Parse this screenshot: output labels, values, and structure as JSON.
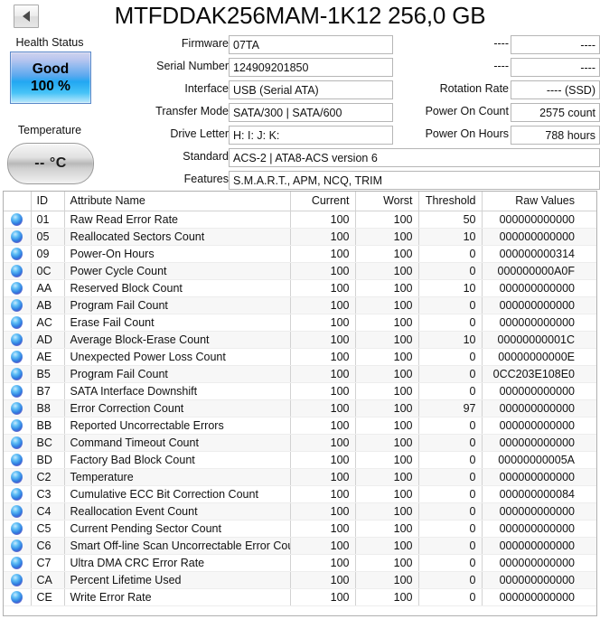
{
  "window": {
    "title": "MTFDDAK256MAM-1K12 256,0 GB",
    "nav_prev_icon": "triangle-left-icon"
  },
  "health": {
    "label": "Health Status",
    "status": "Good",
    "percent": "100 %",
    "color": "#22a7f2"
  },
  "temperature": {
    "label": "Temperature",
    "value": "-- °C"
  },
  "info": {
    "rows": [
      {
        "label": "Firmware",
        "value": "07TA",
        "label2": "----",
        "value2": "----"
      },
      {
        "label": "Serial Number",
        "value": "124909201850",
        "label2": "----",
        "value2": "----"
      },
      {
        "label": "Interface",
        "value": "USB (Serial ATA)",
        "label2": "Rotation Rate",
        "value2": "---- (SSD)"
      },
      {
        "label": "Transfer Mode",
        "value": "SATA/300 | SATA/600",
        "label2": "Power On Count",
        "value2": "2575 count"
      },
      {
        "label": "Drive Letter",
        "value": "H: I: J: K:",
        "label2": "Power On Hours",
        "value2": "788 hours"
      }
    ],
    "wide_rows": [
      {
        "label": "Standard",
        "value": "ACS-2 | ATA8-ACS version 6"
      },
      {
        "label": "Features",
        "value": "S.M.A.R.T., APM, NCQ, TRIM"
      }
    ]
  },
  "attributes": {
    "columns": [
      "",
      "ID",
      "Attribute Name",
      "Current",
      "Worst",
      "Threshold",
      "Raw Values"
    ],
    "rows": [
      {
        "icon": "status-sphere-icon",
        "id": "01",
        "name": "Raw Read Error Rate",
        "current": "100",
        "worst": "100",
        "threshold": "50",
        "raw": "000000000000"
      },
      {
        "icon": "status-sphere-icon",
        "id": "05",
        "name": "Reallocated Sectors Count",
        "current": "100",
        "worst": "100",
        "threshold": "10",
        "raw": "000000000000"
      },
      {
        "icon": "status-sphere-icon",
        "id": "09",
        "name": "Power-On Hours",
        "current": "100",
        "worst": "100",
        "threshold": "0",
        "raw": "000000000314"
      },
      {
        "icon": "status-sphere-icon",
        "id": "0C",
        "name": "Power Cycle Count",
        "current": "100",
        "worst": "100",
        "threshold": "0",
        "raw": "000000000A0F"
      },
      {
        "icon": "status-sphere-icon",
        "id": "AA",
        "name": "Reserved Block Count",
        "current": "100",
        "worst": "100",
        "threshold": "10",
        "raw": "000000000000"
      },
      {
        "icon": "status-sphere-icon",
        "id": "AB",
        "name": "Program Fail Count",
        "current": "100",
        "worst": "100",
        "threshold": "0",
        "raw": "000000000000"
      },
      {
        "icon": "status-sphere-icon",
        "id": "AC",
        "name": "Erase Fail Count",
        "current": "100",
        "worst": "100",
        "threshold": "0",
        "raw": "000000000000"
      },
      {
        "icon": "status-sphere-icon",
        "id": "AD",
        "name": "Average Block-Erase Count",
        "current": "100",
        "worst": "100",
        "threshold": "10",
        "raw": "00000000001C"
      },
      {
        "icon": "status-sphere-icon",
        "id": "AE",
        "name": "Unexpected Power Loss Count",
        "current": "100",
        "worst": "100",
        "threshold": "0",
        "raw": "00000000000E"
      },
      {
        "icon": "status-sphere-icon",
        "id": "B5",
        "name": "Program Fail Count",
        "current": "100",
        "worst": "100",
        "threshold": "0",
        "raw": "0CC203E108E0"
      },
      {
        "icon": "status-sphere-icon",
        "id": "B7",
        "name": "SATA Interface Downshift",
        "current": "100",
        "worst": "100",
        "threshold": "0",
        "raw": "000000000000"
      },
      {
        "icon": "status-sphere-icon",
        "id": "B8",
        "name": "Error Correction Count",
        "current": "100",
        "worst": "100",
        "threshold": "97",
        "raw": "000000000000"
      },
      {
        "icon": "status-sphere-icon",
        "id": "BB",
        "name": "Reported Uncorrectable Errors",
        "current": "100",
        "worst": "100",
        "threshold": "0",
        "raw": "000000000000"
      },
      {
        "icon": "status-sphere-icon",
        "id": "BC",
        "name": "Command Timeout Count",
        "current": "100",
        "worst": "100",
        "threshold": "0",
        "raw": "000000000000"
      },
      {
        "icon": "status-sphere-icon",
        "id": "BD",
        "name": "Factory Bad Block Count",
        "current": "100",
        "worst": "100",
        "threshold": "0",
        "raw": "00000000005A"
      },
      {
        "icon": "status-sphere-icon",
        "id": "C2",
        "name": "Temperature",
        "current": "100",
        "worst": "100",
        "threshold": "0",
        "raw": "000000000000"
      },
      {
        "icon": "status-sphere-icon",
        "id": "C3",
        "name": "Cumulative ECC Bit Correction Count",
        "current": "100",
        "worst": "100",
        "threshold": "0",
        "raw": "000000000084"
      },
      {
        "icon": "status-sphere-icon",
        "id": "C4",
        "name": "Reallocation Event Count",
        "current": "100",
        "worst": "100",
        "threshold": "0",
        "raw": "000000000000"
      },
      {
        "icon": "status-sphere-icon",
        "id": "C5",
        "name": "Current Pending Sector Count",
        "current": "100",
        "worst": "100",
        "threshold": "0",
        "raw": "000000000000"
      },
      {
        "icon": "status-sphere-icon",
        "id": "C6",
        "name": "Smart Off-line Scan Uncorrectable Error Count",
        "current": "100",
        "worst": "100",
        "threshold": "0",
        "raw": "000000000000"
      },
      {
        "icon": "status-sphere-icon",
        "id": "C7",
        "name": "Ultra DMA CRC Error Rate",
        "current": "100",
        "worst": "100",
        "threshold": "0",
        "raw": "000000000000"
      },
      {
        "icon": "status-sphere-icon",
        "id": "CA",
        "name": "Percent Lifetime Used",
        "current": "100",
        "worst": "100",
        "threshold": "0",
        "raw": "000000000000"
      },
      {
        "icon": "status-sphere-icon",
        "id": "CE",
        "name": "Write Error Rate",
        "current": "100",
        "worst": "100",
        "threshold": "0",
        "raw": "000000000000"
      }
    ]
  }
}
